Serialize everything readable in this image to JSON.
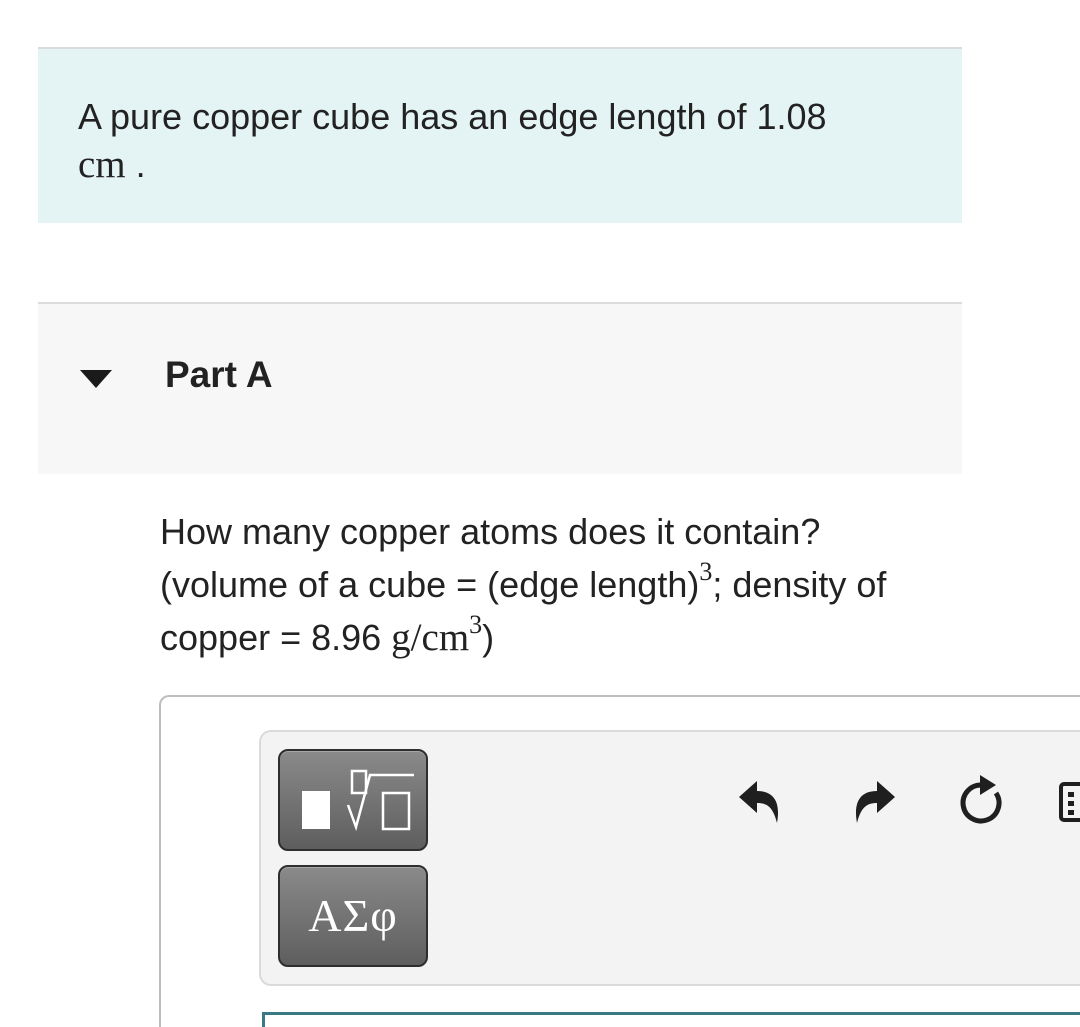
{
  "intro": {
    "text": "A pure copper cube has an edge length of 1.08",
    "unit": "cm",
    "end": "."
  },
  "part": {
    "title": "Part A"
  },
  "question": {
    "line1": "How many copper atoms does it contain?",
    "line2_a": "(volume of a cube = (edge length)",
    "exp": "3",
    "line2_b": "; density of",
    "line3_a": "copper = 8.96 ",
    "line3_unit": "g/cm",
    "exp2": "3",
    "line3_b": ")"
  },
  "toolbar": {
    "symbols_label": "ΑΣφ",
    "icons": {
      "templates": "templates-icon",
      "undo": "undo-icon",
      "redo": "redo-icon",
      "reset": "reset-icon",
      "keyboard": "keyboard-icon"
    }
  },
  "colors": {
    "intro_bg": "#e4f4f5",
    "part_bg": "#f7f7f7",
    "toolbar_bg": "#f3f3f3",
    "button_dark": "#6e6e6e",
    "input_border": "#3a7a86"
  }
}
